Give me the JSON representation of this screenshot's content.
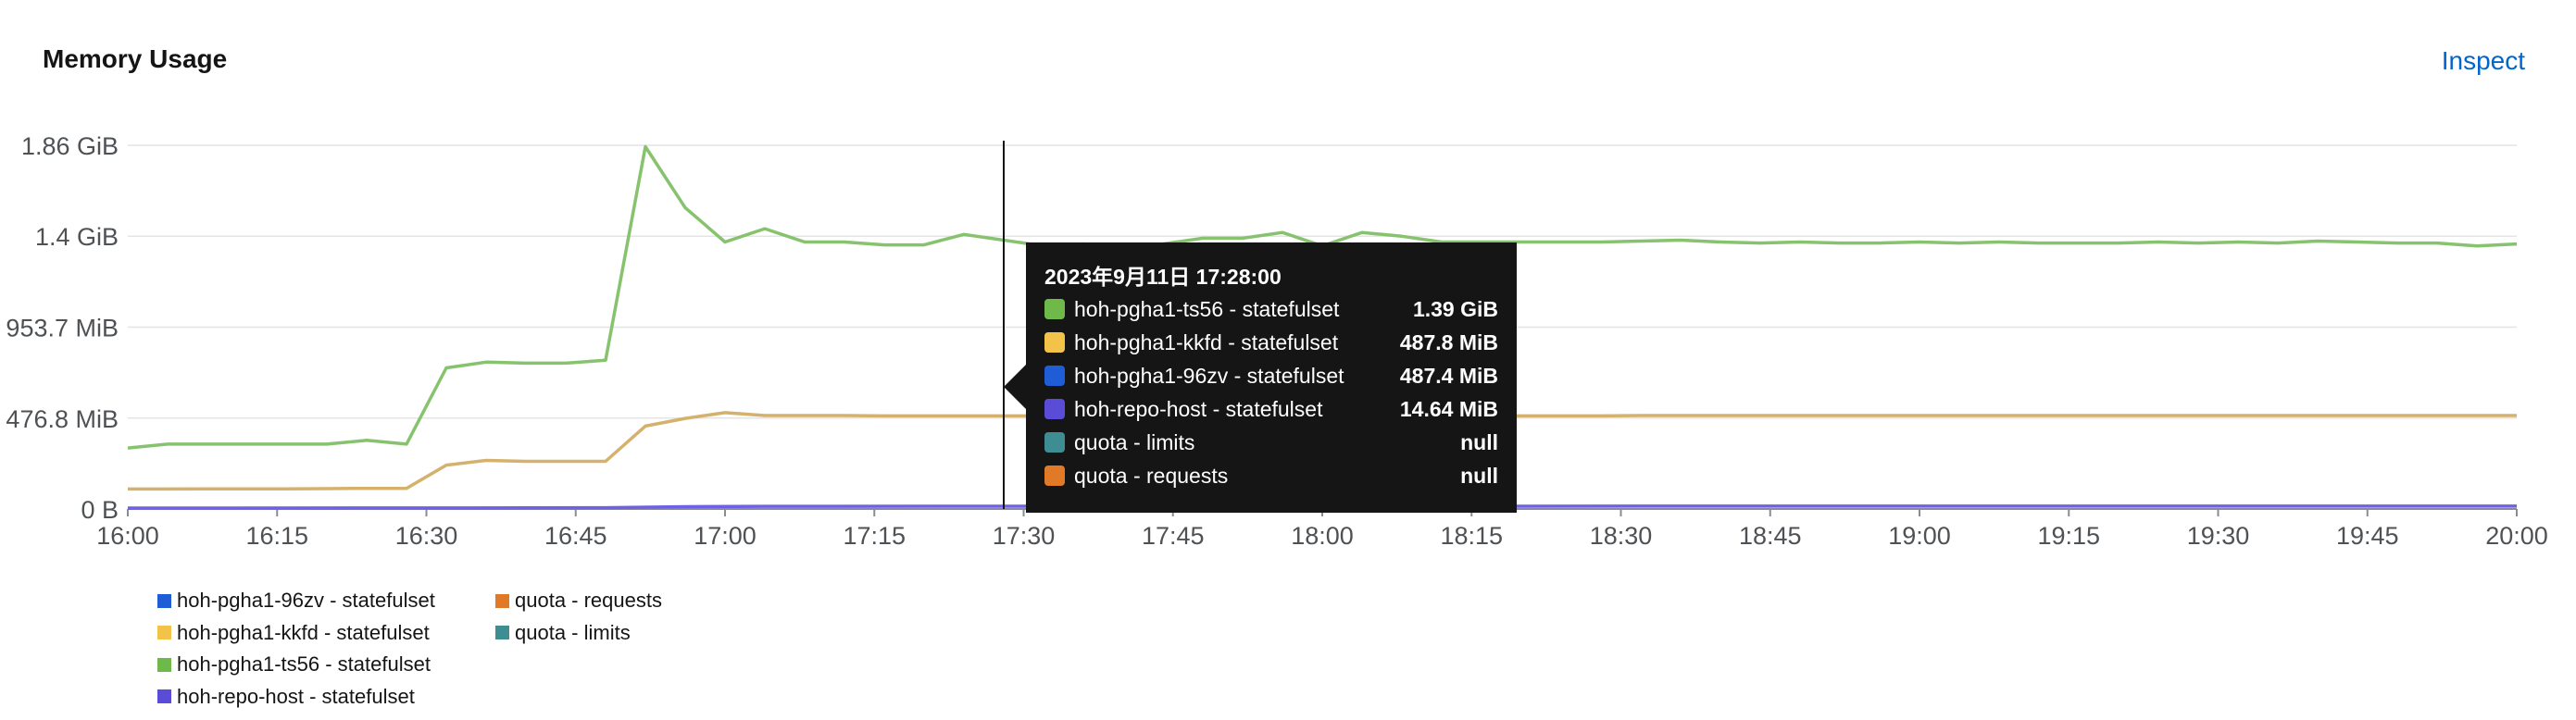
{
  "card": {
    "title": "Memory Usage",
    "inspect_label": "Inspect"
  },
  "colors": {
    "ts56": "#87c36e",
    "kkfd": "#d4b26e",
    "96zv": "#1f5dd6",
    "repo_host": "#5b4cd8",
    "quota_limits": "#3e8d93",
    "quota_requests": "#e07a26"
  },
  "tooltip": {
    "title": "2023年9月11日 17:28:00",
    "rows": [
      {
        "name": "hoh-pgha1-ts56 - statefulset",
        "value": "1.39 GiB",
        "color": "#6fb94a"
      },
      {
        "name": "hoh-pgha1-kkfd - statefulset",
        "value": "487.8 MiB",
        "color": "#f2c348"
      },
      {
        "name": "hoh-pgha1-96zv - statefulset",
        "value": "487.4 MiB",
        "color": "#1f5dd6"
      },
      {
        "name": "hoh-repo-host - statefulset",
        "value": "14.64 MiB",
        "color": "#5b4cd8"
      },
      {
        "name": "quota - limits",
        "value": "null",
        "color": "#3e8d93"
      },
      {
        "name": "quota - requests",
        "value": "null",
        "color": "#e07a26"
      }
    ]
  },
  "legend": [
    {
      "name": "hoh-pgha1-96zv - statefulset",
      "color": "#1f5dd6"
    },
    {
      "name": "hoh-pgha1-kkfd - statefulset",
      "color": "#f2c348"
    },
    {
      "name": "hoh-pgha1-ts56 - statefulset",
      "color": "#6fb94a"
    },
    {
      "name": "hoh-repo-host - statefulset",
      "color": "#5b4cd8"
    },
    {
      "name": "quota - requests",
      "color": "#e07a26"
    },
    {
      "name": "quota - limits",
      "color": "#3e8d93"
    }
  ],
  "chart_data": {
    "type": "line",
    "x_tick_labels": [
      "16:00",
      "16:15",
      "16:30",
      "16:45",
      "17:00",
      "17:15",
      "17:30",
      "17:45",
      "18:00",
      "18:15",
      "18:30",
      "18:45",
      "19:00",
      "19:15",
      "19:30",
      "19:45",
      "20:00"
    ],
    "y_tick_labels": [
      "0 B",
      "476.8 MiB",
      "953.7 MiB",
      "1.4 GiB",
      "1.86 GiB"
    ],
    "y_tick_values_mib": [
      0,
      476.8,
      953.7,
      1430.5,
      1907.3
    ],
    "ylim_mib": [
      0,
      1907.3
    ],
    "xlim_min": [
      0,
      240
    ],
    "grid": true,
    "cursor_x_min": 88,
    "series": [
      {
        "name": "hoh-pgha1-ts56 - statefulset",
        "color": "#87c36e",
        "x_min": [
          0,
          4,
          8,
          12,
          16,
          20,
          24,
          28,
          32,
          36,
          40,
          44,
          48,
          52,
          56,
          60,
          64,
          68,
          72,
          76,
          80,
          84,
          88,
          92,
          96,
          100,
          104,
          108,
          112,
          116,
          120,
          124,
          128,
          132,
          136,
          140,
          144,
          148,
          152,
          156,
          160,
          164,
          168,
          172,
          176,
          180,
          184,
          188,
          192,
          196,
          200,
          204,
          208,
          212,
          216,
          220,
          224,
          228,
          232,
          236,
          240
        ],
        "y_mib": [
          320,
          340,
          340,
          340,
          340,
          340,
          360,
          340,
          740,
          770,
          765,
          765,
          780,
          1900,
          1580,
          1400,
          1470,
          1400,
          1400,
          1385,
          1385,
          1440,
          1410,
          1380,
          1390,
          1380,
          1390,
          1420,
          1420,
          1450,
          1380,
          1450,
          1430,
          1400,
          1400,
          1400,
          1400,
          1400,
          1405,
          1410,
          1400,
          1395,
          1400,
          1395,
          1395,
          1400,
          1395,
          1400,
          1395,
          1395,
          1395,
          1400,
          1395,
          1400,
          1395,
          1405,
          1400,
          1395,
          1395,
          1380,
          1390
        ]
      },
      {
        "name": "hoh-pgha1-kkfd - statefulset",
        "color": "#d4b26e",
        "x_min": [
          0,
          4,
          8,
          12,
          16,
          20,
          24,
          28,
          32,
          36,
          40,
          44,
          48,
          52,
          56,
          60,
          64,
          68,
          72,
          76,
          80,
          84,
          88,
          92,
          96,
          100,
          104,
          108,
          112,
          116,
          120,
          124,
          128,
          132,
          136,
          140,
          144,
          148,
          152,
          156,
          160,
          164,
          168,
          172,
          176,
          180,
          184,
          188,
          192,
          196,
          200,
          204,
          208,
          212,
          216,
          220,
          224,
          228,
          232,
          236,
          240
        ],
        "y_mib": [
          105,
          105,
          106,
          106,
          106,
          107,
          108,
          108,
          230,
          255,
          250,
          250,
          250,
          435,
          475,
          505,
          490,
          490,
          490,
          488,
          488,
          488,
          488,
          488,
          488,
          488,
          488,
          488,
          488,
          488,
          488,
          488,
          488,
          488,
          488,
          488,
          488,
          488,
          490,
          490,
          490,
          490,
          490,
          490,
          490,
          490,
          490,
          490,
          490,
          490,
          490,
          490,
          490,
          490,
          490,
          490,
          490,
          490,
          490,
          490,
          490
        ]
      },
      {
        "name": "hoh-repo-host - statefulset",
        "color": "#6f61e3",
        "x_min": [
          0,
          40,
          48,
          56,
          64,
          88,
          120,
          160,
          200,
          240
        ],
        "y_mib": [
          5,
          6,
          7,
          12,
          14,
          14.6,
          14.6,
          15,
          15,
          15
        ]
      }
    ]
  }
}
